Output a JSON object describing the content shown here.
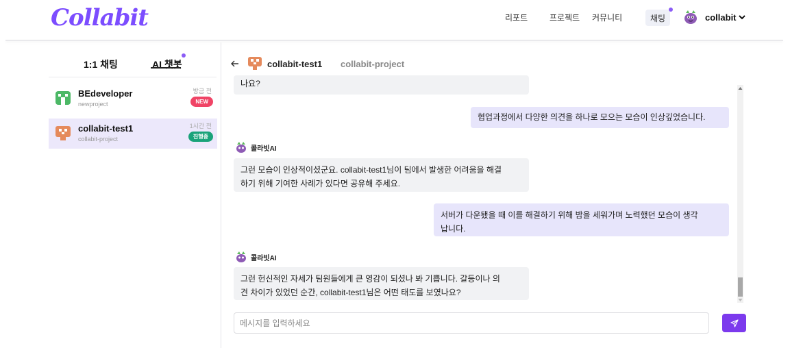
{
  "header": {
    "logo": "Collabit",
    "nav": [
      "리포트",
      "프로젝트",
      "커뮤니티"
    ],
    "chat_label": "채팅",
    "user_name": "collabit",
    "accent": "#7c4dff"
  },
  "sidebar": {
    "tabs": [
      "1:1 채팅",
      "AI 챗봇"
    ],
    "rooms": [
      {
        "name": "BEdeveloper",
        "project": "newproject",
        "time": "방금 전",
        "badge": "NEW",
        "icon": "green-avatar-icon"
      },
      {
        "name": "collabit-test1",
        "project": "collabit-project",
        "time": "1시간 전",
        "badge": "진행중",
        "icon": "orange-avatar-icon"
      }
    ]
  },
  "chat": {
    "title": "collabit-test1",
    "subtitle": "collabit-project",
    "ai_name": "콜라빗AI",
    "messages": [
      {
        "role": "ai",
        "text": "나요?"
      },
      {
        "role": "user",
        "text": "협업과정에서 다양한 의견을 하나로 모으는 모습이 인상깊었습니다."
      },
      {
        "role": "ai",
        "line1": "그런 모습이 인상적이셨군요. collabit-test1님이 팀에서 발생한 어려움을 해결",
        "line2": "하기 위해 기여한 사례가 있다면 공유해 주세요."
      },
      {
        "role": "user",
        "line1": "서버가 다운됐을 때 이를 해결하기 위해 밤을 세워가며 노력했던 모습이 생각",
        "line2": "납니다."
      },
      {
        "role": "ai",
        "line1": "그런 헌신적인 자세가 팀원들에게 큰 영감이 되셨나 봐 기쁩니다. 갈등이나 의",
        "line2": "견 차이가 있었던 순간, collabit-test1님은 어떤 태도를 보였나요?"
      }
    ],
    "input_placeholder": "메시지를 입력하세요",
    "send_icon": "send-icon",
    "send_color": "#7c3aed"
  }
}
